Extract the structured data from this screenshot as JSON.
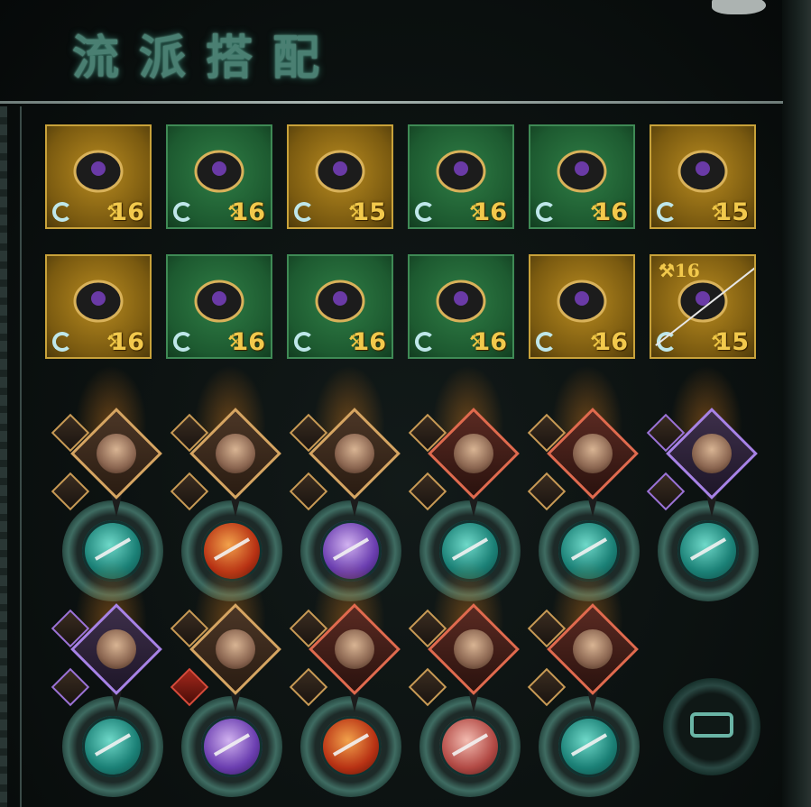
{
  "title": "流派搭配",
  "equipment": [
    {
      "slot": "weapon",
      "frame": "gold",
      "icon": "sword-icon",
      "level": "16"
    },
    {
      "slot": "gloves",
      "frame": "green",
      "icon": "gauntlet-icon",
      "level": "16"
    },
    {
      "slot": "armor",
      "frame": "gold",
      "icon": "chest-armor-icon",
      "level": "15"
    },
    {
      "slot": "belt",
      "frame": "green",
      "icon": "belt-icon",
      "level": "16"
    },
    {
      "slot": "boots",
      "frame": "green",
      "icon": "boots-icon",
      "level": "16"
    },
    {
      "slot": "necklace",
      "frame": "gold",
      "icon": "amulet-icon",
      "level": "15"
    },
    {
      "slot": "emblem",
      "frame": "gold",
      "icon": "emblem-icon",
      "level": "16"
    },
    {
      "slot": "cloak",
      "frame": "green",
      "icon": "cloak-icon",
      "level": "16"
    },
    {
      "slot": "bracer",
      "frame": "green",
      "icon": "bracer-icon",
      "level": "16"
    },
    {
      "slot": "sash",
      "frame": "green",
      "icon": "sash-icon",
      "level": "16"
    },
    {
      "slot": "pauldron",
      "frame": "gold",
      "icon": "pauldron-icon",
      "level": "16"
    },
    {
      "slot": "rings",
      "frame": "gold",
      "icon": "ring-icon",
      "level": "16",
      "level2": "15"
    }
  ],
  "characters_row1": [
    {
      "portrait": "gold",
      "skill": "teal",
      "small": [
        "gold",
        "gold"
      ]
    },
    {
      "portrait": "gold",
      "skill": "red",
      "small": [
        "gold",
        "gold"
      ]
    },
    {
      "portrait": "gold",
      "skill": "purple",
      "small": [
        "gold",
        "gold"
      ]
    },
    {
      "portrait": "red",
      "skill": "teal",
      "small": [
        "gold",
        "gold"
      ]
    },
    {
      "portrait": "red",
      "skill": "teal",
      "small": [
        "gold",
        "gold"
      ]
    },
    {
      "portrait": "purple",
      "skill": "teal",
      "small": [
        "purple",
        "purple"
      ]
    }
  ],
  "characters_row2": [
    {
      "portrait": "purple",
      "skill": "teal",
      "small": [
        "purple",
        "purple"
      ]
    },
    {
      "portrait": "gold",
      "skill": "purple",
      "small": [
        "gold",
        "red"
      ]
    },
    {
      "portrait": "red",
      "skill": "red",
      "small": [
        "gold",
        "gold"
      ]
    },
    {
      "portrait": "red",
      "skill": "pink",
      "small": [
        "gold",
        "gold"
      ]
    },
    {
      "portrait": "red",
      "skill": "teal",
      "small": [
        "gold",
        "gold"
      ]
    }
  ],
  "colors": {
    "accent": "#4a7f72",
    "level_text": "#f2c94c",
    "gold_frame": "#c8a23a",
    "green_frame": "#3f8a55"
  }
}
